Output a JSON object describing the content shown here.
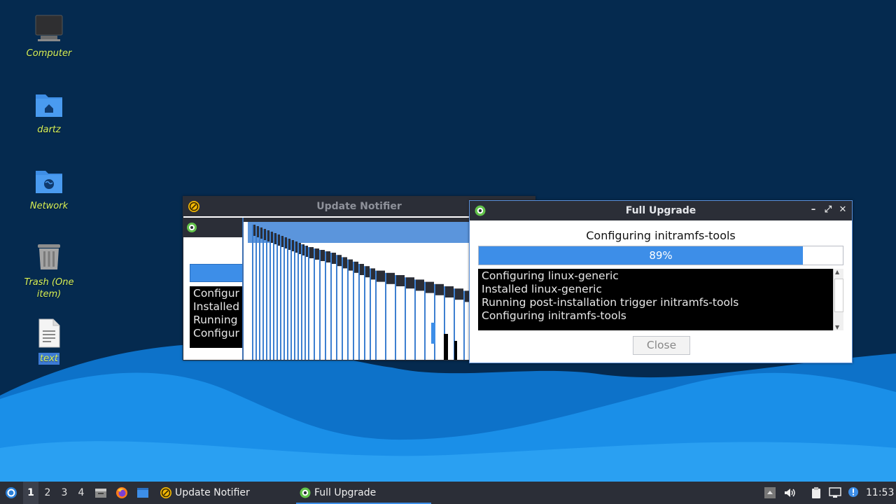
{
  "desktop": {
    "icons": [
      {
        "label": "Computer",
        "icon": "monitor-icon"
      },
      {
        "label": "dartz",
        "icon": "home-folder-icon"
      },
      {
        "label": "Network",
        "icon": "network-folder-icon"
      },
      {
        "label": "Trash (One item)",
        "icon": "trash-icon"
      },
      {
        "label": "text",
        "icon": "text-file-icon",
        "selected": true
      }
    ]
  },
  "notifier_window": {
    "title": "Update Notifier",
    "log_fragments": [
      "Configur",
      "Installed",
      "Running",
      "Configur"
    ]
  },
  "upgrade_window": {
    "title": "Full Upgrade",
    "status": "Configuring initramfs-tools",
    "progress_label": "89%",
    "progress_fraction": 0.89,
    "log": [
      "Configuring linux-generic",
      "Installed linux-generic",
      "Running post-installation trigger initramfs-tools",
      "Configuring initramfs-tools"
    ],
    "close_label": "Close"
  },
  "panel": {
    "workspaces": [
      "1",
      "2",
      "3",
      "4"
    ],
    "tasks": [
      {
        "label": "Update Notifier",
        "icon": "update-notifier-icon"
      },
      {
        "label": "Full Upgrade",
        "icon": "gear-icon"
      }
    ],
    "clock": "11:53"
  },
  "colors": {
    "desktop_bg": "#052a4f",
    "wave_light": "#1a8fe8",
    "accent": "#3d8ee8",
    "label_yellow": "#d8f25a"
  }
}
